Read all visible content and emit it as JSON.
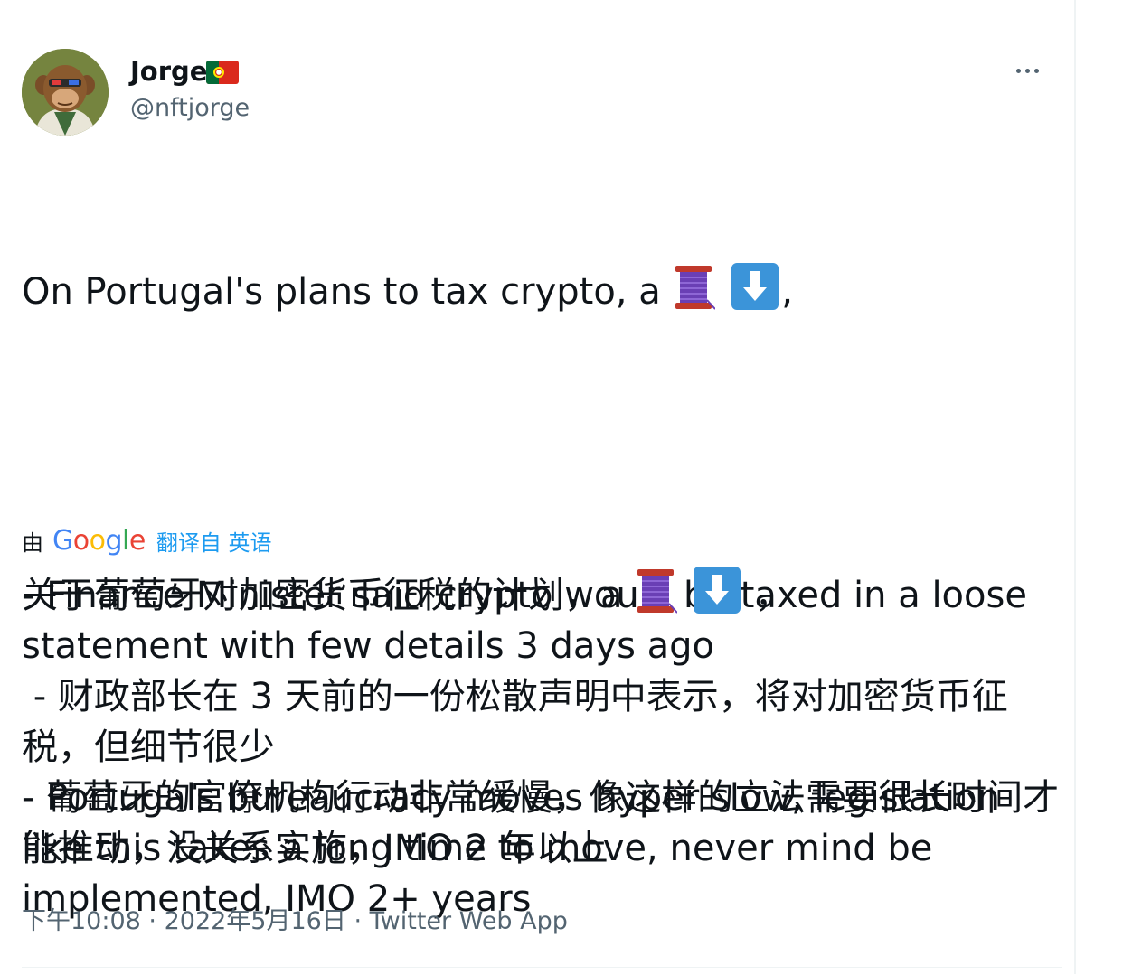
{
  "author": {
    "name": "Jorge",
    "handle": "@nftjorge",
    "flag_icon": "portugal-flag-icon",
    "avatar_icon": "ape-avatar"
  },
  "more_icon": "more-horizontal-icon",
  "tweet": {
    "line_intro": "On Portugal's plans to tax crypto, a",
    "intro_trailing": ",",
    "emoji_thread": "spool-of-thread-icon",
    "emoji_down": "down-arrow-button-icon",
    "paragraph_1": "- Finance Minister said crypto would be taxed in a loose statement with few details 3 days ago",
    "paragraph_2": "- Portugals bureaucracy moves hyper slow, legislation like this takes a long time to move, never mind be implemented, IMO 2+ years"
  },
  "translation": {
    "prefix": "由",
    "provider": "Google",
    "link_text": "翻译自 英语",
    "line_intro": "关于葡萄牙对加密货币征税的计划，a",
    "intro_trailing": "，",
    "paragraph_1": " - 财政部长在 3 天前的一份松散声明中表示，将对加密货币征税，但细节很少",
    "paragraph_2": "- 葡萄牙的官僚机构行动非常缓慢，像这样的立法需要很长时间才能推动，没关系实施，IMO 2 年以上"
  },
  "meta": {
    "time": "下午10:08",
    "date": "2022年5月16日",
    "separator": "·",
    "source": "Twitter Web App"
  },
  "colors": {
    "text": "#0f1419",
    "secondary": "#536471",
    "link": "#1d9bf0",
    "emoji_button": "#1d9bf0",
    "thread_spool": "#6a3fb5"
  }
}
